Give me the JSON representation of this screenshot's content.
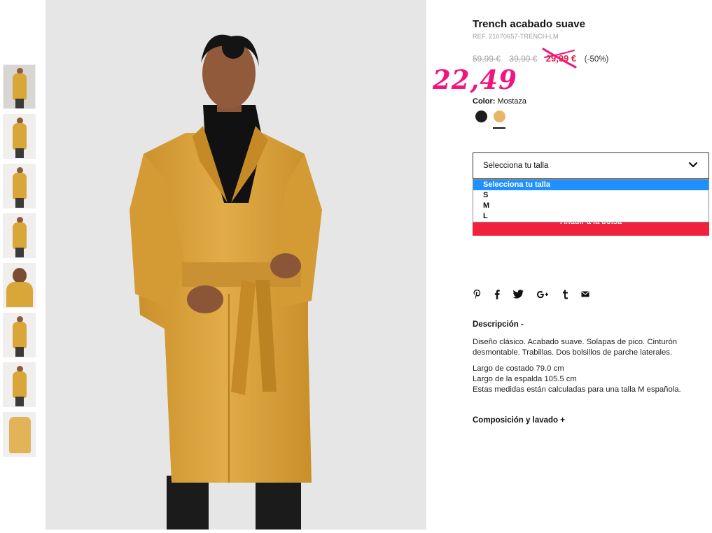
{
  "product": {
    "title": "Trench acabado suave",
    "ref": "REF. 21070657-TRENCH-LM",
    "price_original": "59,99 €",
    "price_previous": "39,99 €",
    "price_current": "29,99 €",
    "discount": "(-50%)",
    "handwritten_price": "22,49"
  },
  "color": {
    "label": "Color:",
    "value": "Mostaza",
    "swatches": [
      {
        "name": "Negro",
        "hex": "#1d1d1d"
      },
      {
        "name": "Mostaza",
        "hex": "#e6b865",
        "selected": true
      }
    ]
  },
  "size_select": {
    "label": "Selecciona tu talla",
    "options": [
      "Selecciona tu talla",
      "S",
      "M",
      "L"
    ],
    "highlighted_index": 0
  },
  "add_to_bag": "Añadir a la bolsa",
  "share_icons": [
    "pinterest-icon",
    "facebook-icon",
    "twitter-icon",
    "google-plus-icon",
    "tumblr-icon",
    "mail-icon"
  ],
  "description": {
    "title": "Descripción -",
    "text1": "Diseño clásico. Acabado suave. Solapas de pico. Cinturón desmontable. Trabillas. Dos bolsillos de parche laterales.",
    "line1": "Largo de costado 79.0 cm",
    "line2": "Largo de la espalda 105.5 cm",
    "line3": "Estas medidas están calculadas para una talla M española."
  },
  "composition_title": "Composición y lavado +",
  "thumbnails_count": 8,
  "colors": {
    "price_red": "#e0243d",
    "button_red": "#f0213d",
    "handwritten_pink": "#f2137f",
    "dropdown_highlight": "#1e90ff"
  }
}
